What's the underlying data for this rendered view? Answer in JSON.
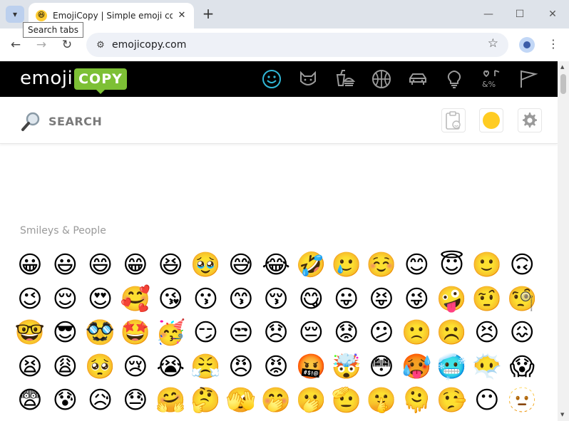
{
  "browser": {
    "tab_title": "EmojiCopy | Simple emoji copy and paste keyboard",
    "tooltip": "Search tabs",
    "url": "emojicopy.com",
    "new_tab": "+",
    "close": "✕",
    "minimize": "—",
    "maximize": "☐",
    "win_close": "✕"
  },
  "site": {
    "logo_word": "emoji",
    "logo_badge": "COPY",
    "search_label": "SEARCH",
    "accent": "#7dc035",
    "active_icon_color": "#31b8d8",
    "icon_color": "#9a9a9a",
    "categories": [
      "smileys-icon",
      "animals-icon",
      "food-icon",
      "activity-icon",
      "travel-icon",
      "objects-icon",
      "symbols-icon",
      "flags-icon"
    ]
  },
  "section": {
    "title": "Smileys & People"
  },
  "emojis": [
    [
      "😀",
      "😃",
      "😄",
      "😁",
      "😆",
      "🥹",
      "😅",
      "😂",
      "🤣",
      "🥲",
      "☺️",
      "😊",
      "😇",
      "🙂",
      "🙃"
    ],
    [
      "😉",
      "😌",
      "😍",
      "🥰",
      "😘",
      "😗",
      "😙",
      "😚",
      "😋",
      "😛",
      "😝",
      "😜",
      "🤪",
      "🤨",
      "🧐"
    ],
    [
      "🤓",
      "😎",
      "🥸",
      "🤩",
      "🥳",
      "😏",
      "😒",
      "😞",
      "😔",
      "😟",
      "😕",
      "🙁",
      "☹️",
      "😣",
      "😖"
    ],
    [
      "😫",
      "😩",
      "🥺",
      "😢",
      "😭",
      "😤",
      "😠",
      "😡",
      "🤬",
      "🤯",
      "😳",
      "🥵",
      "🥶",
      "😶‍🌫️",
      "😱"
    ],
    [
      "😨",
      "😰",
      "😥",
      "😓",
      "🤗",
      "🤔",
      "🫣",
      "🤭",
      "🫢",
      "🫡",
      "🤫",
      "🫠",
      "🤥",
      "😶",
      "🫥"
    ]
  ]
}
